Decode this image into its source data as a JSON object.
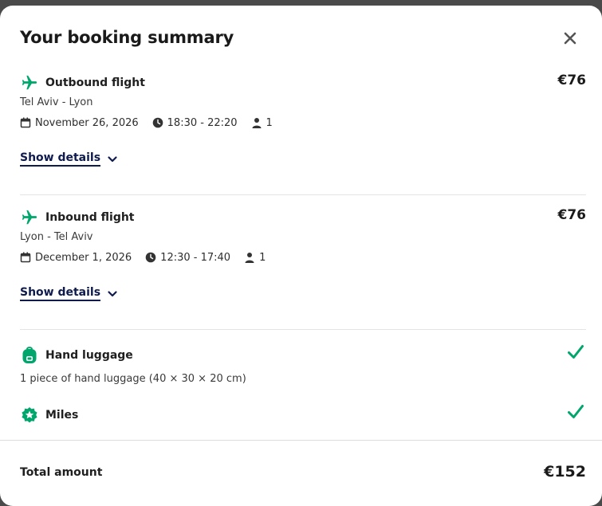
{
  "title": "Your booking summary",
  "outbound": {
    "label": "Outbound flight",
    "price": "€76",
    "route": "Tel Aviv - Lyon",
    "date": "November 26, 2026",
    "time": "18:30 - 22:20",
    "passengers": "1",
    "details_label": "Show details"
  },
  "inbound": {
    "label": "Inbound flight",
    "price": "€76",
    "route": "Lyon - Tel Aviv",
    "date": "December 1, 2026",
    "time": "12:30 - 17:40",
    "passengers": "1",
    "details_label": "Show details"
  },
  "luggage": {
    "label": "Hand luggage",
    "description": "1 piece of hand luggage (40 × 30 × 20 cm)"
  },
  "miles": {
    "label": "Miles"
  },
  "footer": {
    "label": "Total amount",
    "total": "€152"
  },
  "colors": {
    "accent_green": "#00a66c",
    "link_navy": "#0f1b4d"
  },
  "icons": {
    "close": "close-icon",
    "plane": "plane-icon",
    "calendar": "calendar-icon",
    "clock": "clock-icon",
    "person": "person-icon",
    "chevron": "chevron-down-icon",
    "backpack": "backpack-icon",
    "miles": "miles-badge-icon",
    "check": "checkmark-icon"
  }
}
